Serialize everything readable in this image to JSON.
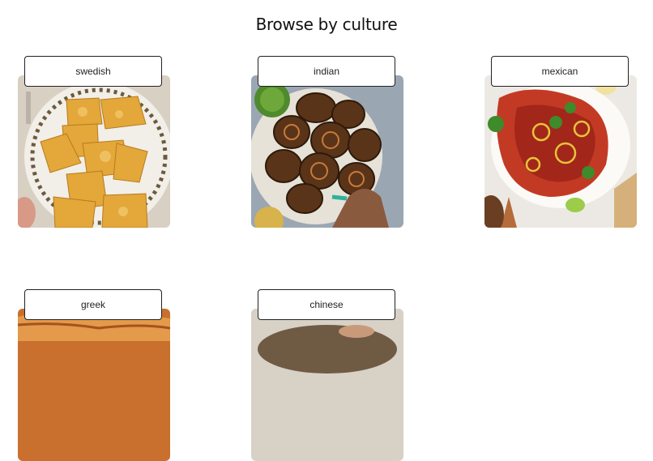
{
  "page": {
    "title": "Browse by culture"
  },
  "cultures": [
    {
      "label": "swedish",
      "image_icon": "swedish-dish-photo"
    },
    {
      "label": "indian",
      "image_icon": "indian-dish-photo"
    },
    {
      "label": "mexican",
      "image_icon": "mexican-dish-photo"
    },
    {
      "label": "greek",
      "image_icon": "greek-dish-photo"
    },
    {
      "label": "chinese",
      "image_icon": "chinese-dish-photo"
    }
  ]
}
